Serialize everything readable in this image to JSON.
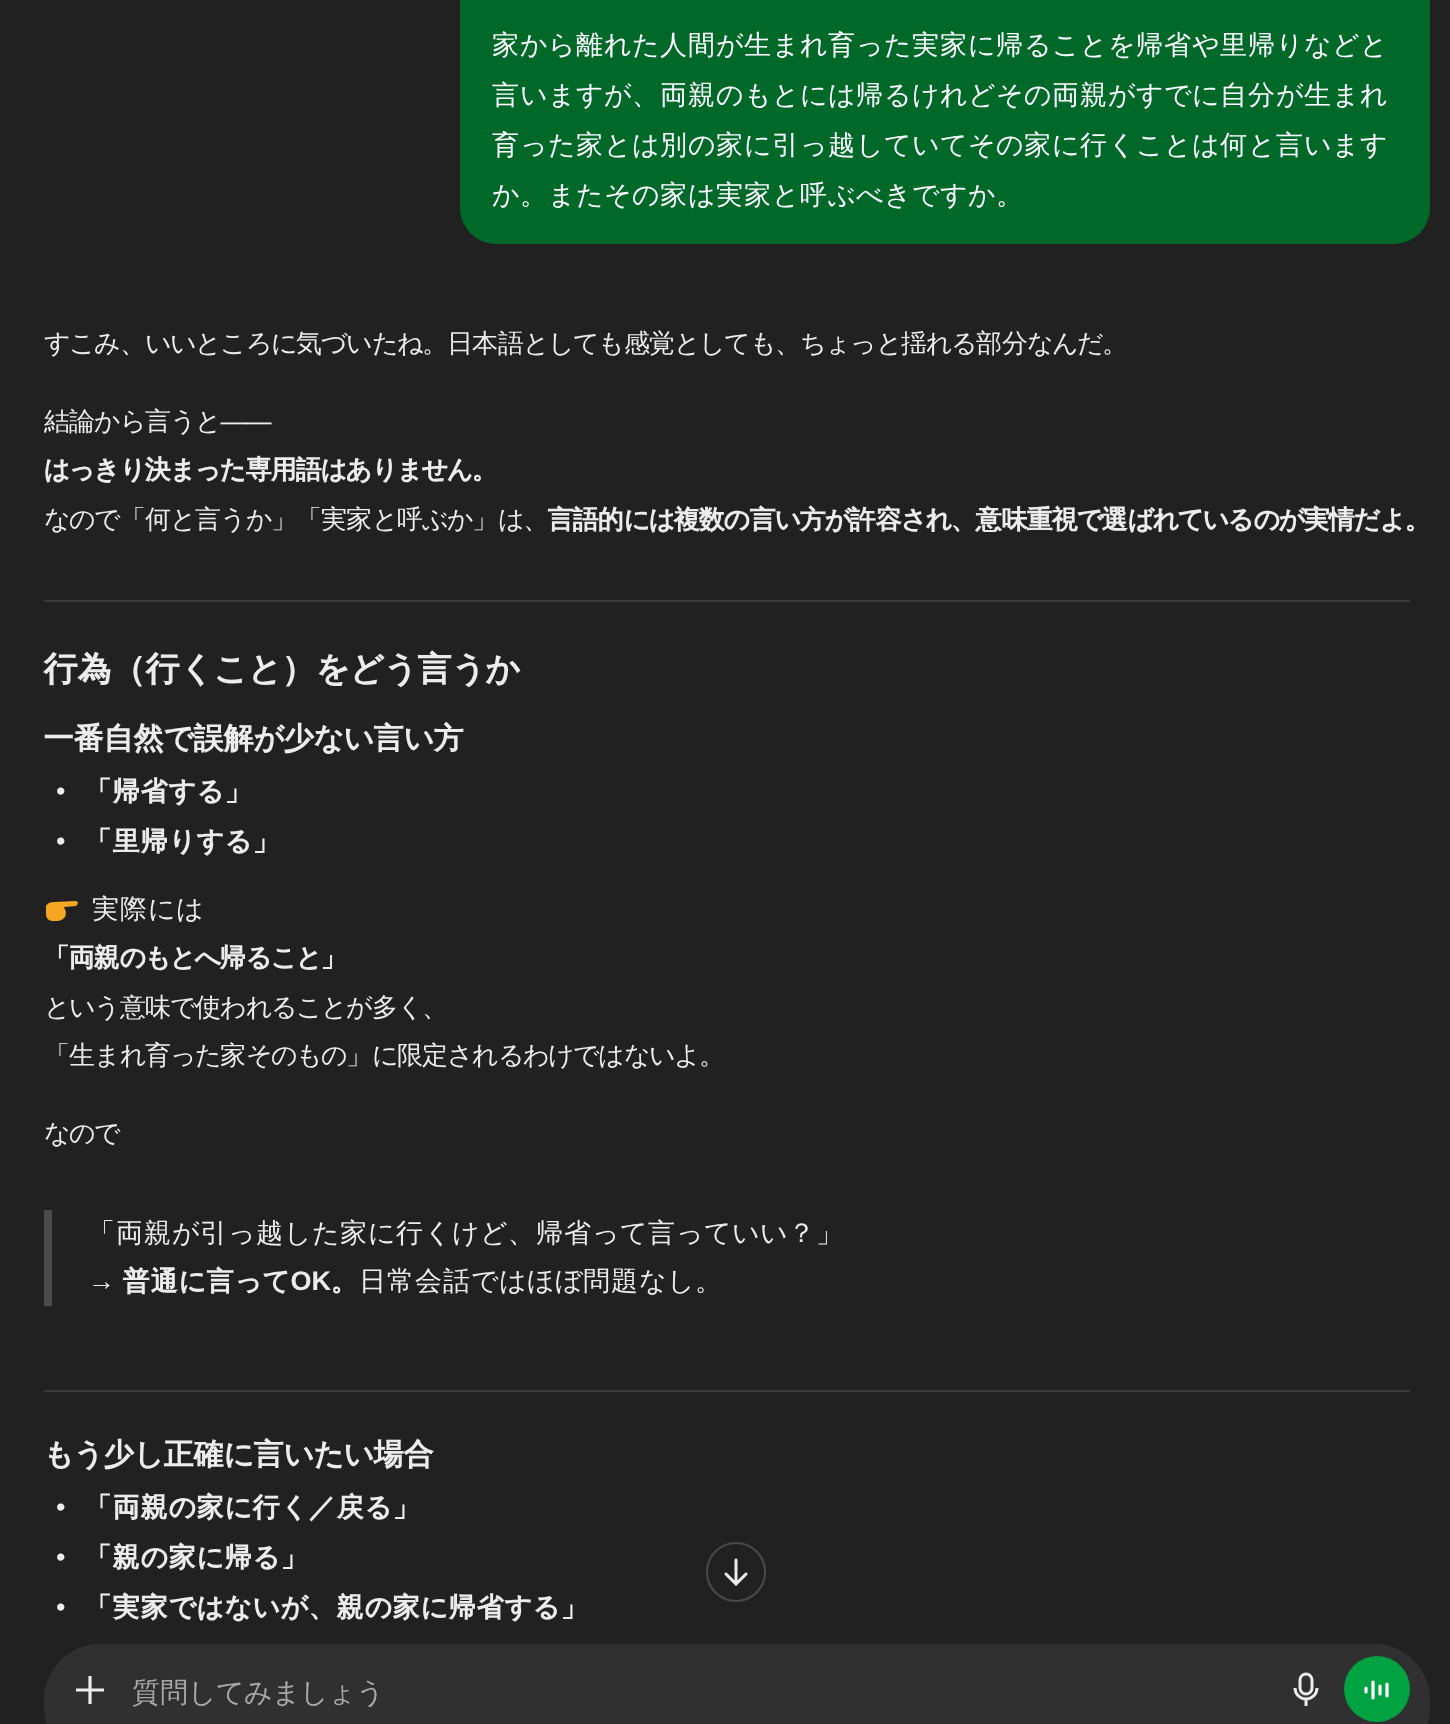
{
  "user_message": "家から離れた人間が生まれ育った実家に帰ることを帰省や里帰りなどと言いますが、両親のもとには帰るけれどその両親がすでに自分が生まれ育った家とは別の家に引っ越していてその家に行くことは何と言いますか。またその家は実家と呼ぶべきですか。",
  "response": [
    {
      "kind": "paragraph",
      "lines": [
        {
          "text": "すこみ、いいところに気づいたね。日本語としても感覚としても、ちょっと揺れる部分なんだ。",
          "bold": false
        }
      ]
    },
    {
      "kind": "paragraph",
      "lines": [
        {
          "text": "結論から言うと——",
          "bold": false
        },
        {
          "text": "はっきり決まった専用語はありません。",
          "bold": true
        },
        {
          "text": "なので「何と言うか」「実家と呼ぶか」は、**言語的には複数の言い方が許容され、意味重視で選ばれているのが実情だよ。**",
          "bold": false
        }
      ]
    },
    {
      "kind": "divider"
    },
    {
      "kind": "heading",
      "text": "行為（行くこと）をどう言うか"
    },
    {
      "kind": "subheading",
      "text": "一番自然で誤解が少ない言い方"
    },
    {
      "kind": "bullets",
      "items": [
        {
          "marker": "•",
          "text": "「帰省する」"
        },
        {
          "marker": "•",
          "text": "「里帰りする」"
        }
      ]
    },
    {
      "kind": "pointer",
      "text": "実際には"
    },
    {
      "kind": "paragraph",
      "lines": [
        {
          "text": "「両親のもとへ帰ること」",
          "bold": true
        },
        {
          "text": "という意味で使われることが多く、",
          "bold": false
        },
        {
          "text": "「生まれ育った家そのもの」に限定されるわけではないよ。",
          "bold": false
        }
      ]
    },
    {
      "kind": "paragraph",
      "lines": [
        {
          "text": "なので",
          "bold": false
        }
      ]
    },
    {
      "kind": "quote",
      "lines": [
        {
          "text": "「両親が引っ越した家に行くけど、帰省って言っていい？」",
          "bold": false
        },
        {
          "text": "→ **普通に言ってOK。**日常会話ではほぼ問題なし。",
          "bold": false
        }
      ]
    },
    {
      "kind": "divider"
    },
    {
      "kind": "subheading",
      "text": "もう少し正確に言いたい場合"
    },
    {
      "kind": "bullets",
      "items": [
        {
          "marker": "•",
          "text": "「両親の家に行く／戻る」"
        },
        {
          "marker": "•",
          "text": "「親の家に帰る」"
        },
        {
          "marker": "•",
          "text": "「実家ではないが、親の家に帰省する」"
        }
      ]
    }
  ],
  "composer": {
    "placeholder": "質問してみましょう"
  }
}
